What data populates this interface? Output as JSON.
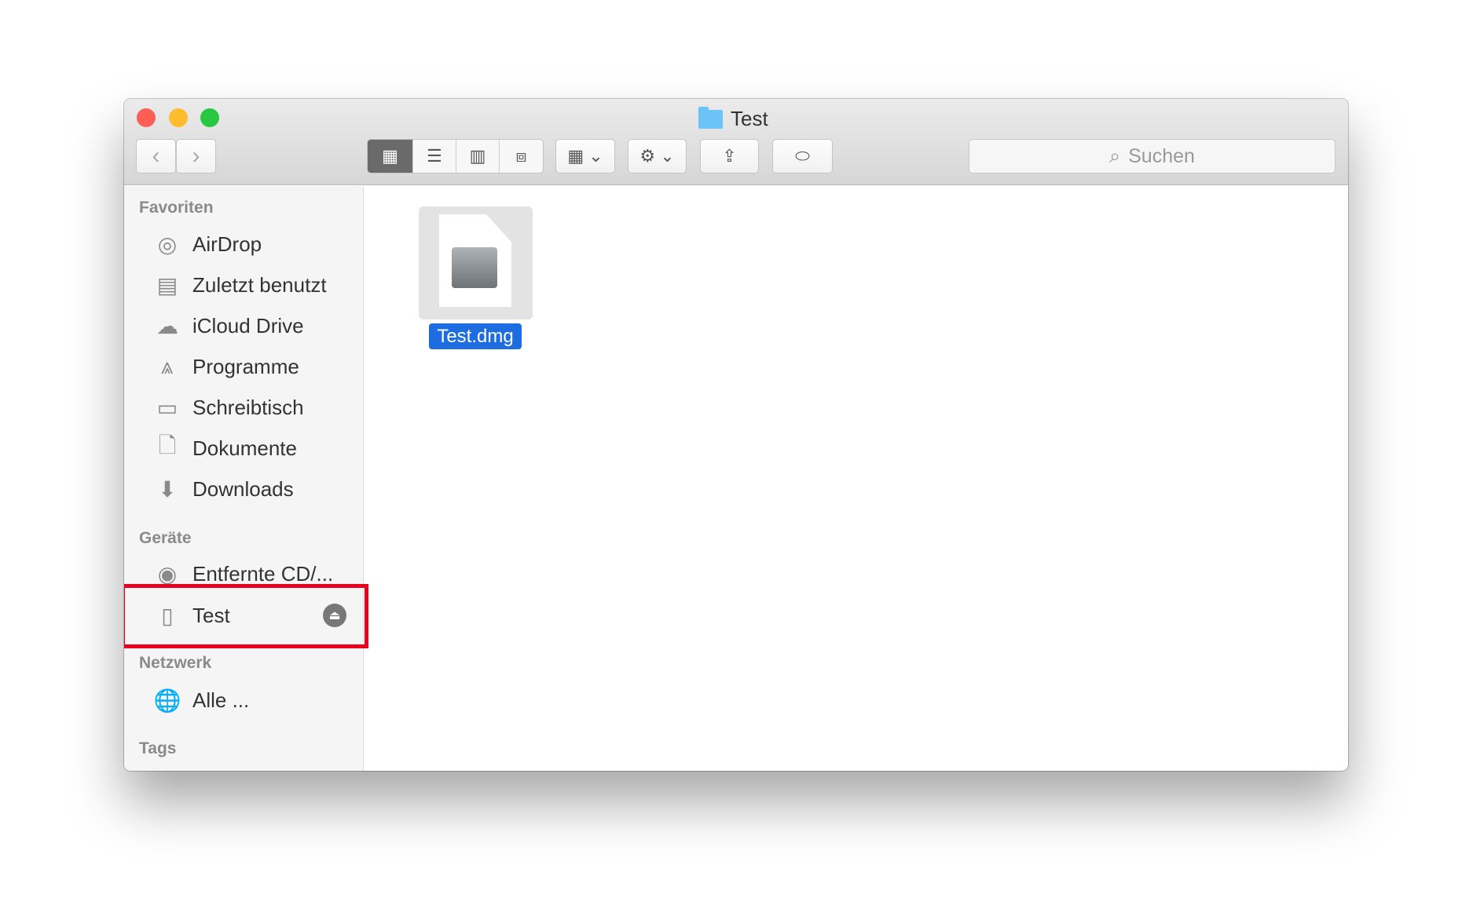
{
  "window": {
    "title": "Test",
    "traffic_lights": {
      "close": "#fd5f57",
      "minimize": "#febc2e",
      "zoom": "#28c840"
    }
  },
  "toolbar": {
    "back_icon": "chevron-left",
    "forward_icon": "chevron-right",
    "view_modes": [
      "icon",
      "list",
      "column",
      "cover-flow"
    ],
    "active_view": "icon",
    "search_placeholder": "Suchen"
  },
  "sidebar": {
    "sections": [
      {
        "title": "Favoriten",
        "items": [
          {
            "label": "AirDrop",
            "icon": "airdrop-icon"
          },
          {
            "label": "Zuletzt benutzt",
            "icon": "recents-icon"
          },
          {
            "label": "iCloud Drive",
            "icon": "cloud-icon"
          },
          {
            "label": "Programme",
            "icon": "applications-icon"
          },
          {
            "label": "Schreibtisch",
            "icon": "desktop-icon"
          },
          {
            "label": "Dokumente",
            "icon": "documents-icon"
          },
          {
            "label": "Downloads",
            "icon": "downloads-icon"
          }
        ]
      },
      {
        "title": "Geräte",
        "items": [
          {
            "label": "Entfernte CD/...",
            "icon": "disc-icon"
          },
          {
            "label": "Test",
            "icon": "drive-icon",
            "ejectable": true,
            "highlighted": true
          }
        ]
      },
      {
        "title": "Netzwerk",
        "items": [
          {
            "label": "Alle ...",
            "icon": "network-icon"
          }
        ]
      },
      {
        "title": "Tags",
        "items": []
      }
    ]
  },
  "main": {
    "files": [
      {
        "name": "Test.dmg",
        "selected": true
      }
    ]
  },
  "colors": {
    "highlight_box": "#e8001c",
    "selection": "#1d6ce0"
  }
}
